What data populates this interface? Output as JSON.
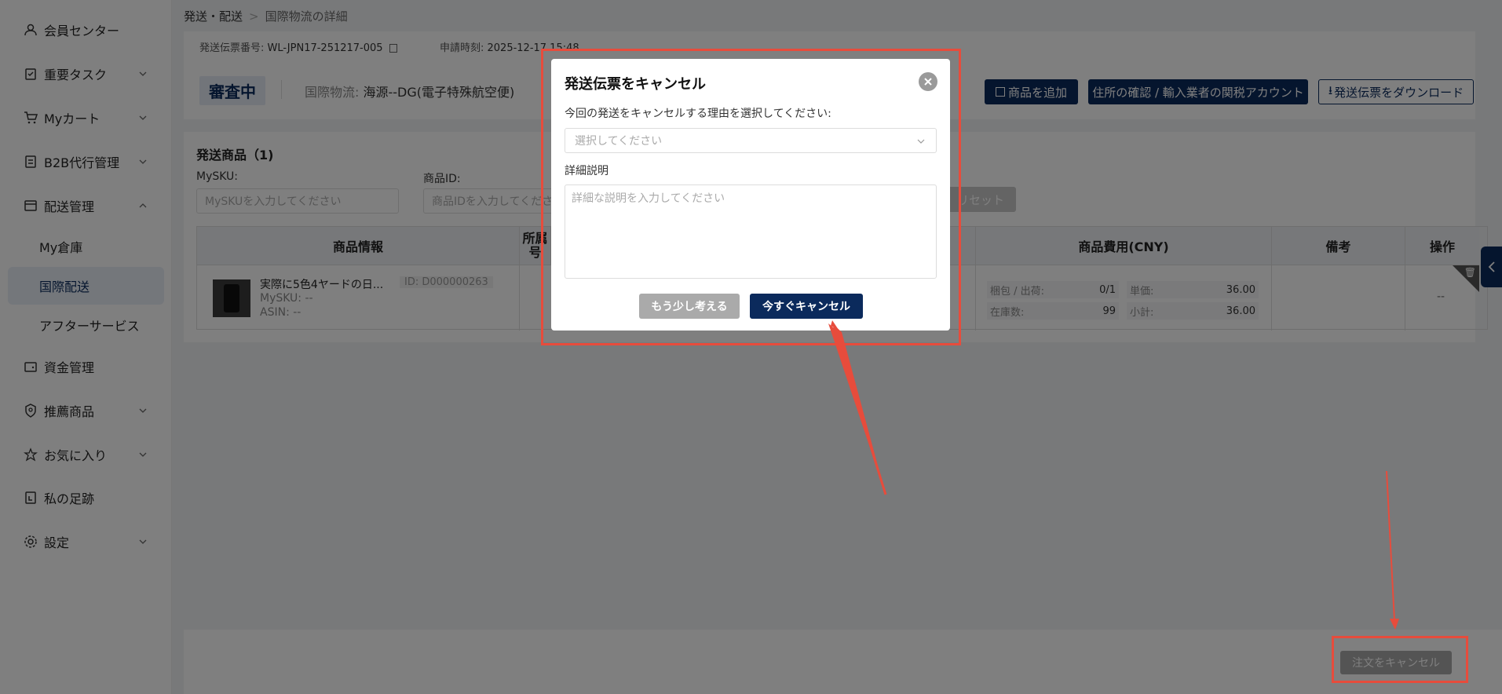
{
  "sidebar": {
    "items": [
      {
        "label": "会員センター"
      },
      {
        "label": "重要タスク"
      },
      {
        "label": "Myカート"
      },
      {
        "label": "B2B代行管理"
      },
      {
        "label": "配送管理"
      },
      {
        "label": "資金管理"
      },
      {
        "label": "推薦商品"
      },
      {
        "label": "お気に入り"
      },
      {
        "label": "私の足跡"
      },
      {
        "label": "設定"
      }
    ],
    "sub_items": [
      {
        "label": "My倉庫"
      },
      {
        "label": "国際配送",
        "active": true
      },
      {
        "label": "アフターサービス"
      }
    ]
  },
  "breadcrumb": {
    "parent": "発送・配送",
    "current": "国際物流の詳細"
  },
  "header": {
    "invoice_label": "発送伝票番号: ",
    "invoice_no": "WL-JPN17-251217-005",
    "applied_label": "申請時刻: ",
    "applied_at": "2025-12-17 15:48",
    "status": "審査中",
    "logistics_label": "国際物流: ",
    "logistics_value": "海源--DG(電子特殊航空便)",
    "add_goods": "商品を追加",
    "address_confirm": "住所の確認 / 輸入業者の関税アカウント",
    "download": "発送伝票をダウンロード"
  },
  "goods": {
    "title": "発送商品（1)",
    "filter_sku_label": "MySKU:",
    "filter_sku_placeholder": "MySKUを入力してください",
    "filter_id_label": "商品ID:",
    "filter_id_placeholder": "商品IDを入力してくださ",
    "reset": "リセット",
    "columns": {
      "info": "商品情報",
      "owner": "所属",
      "owner_suffix": "号",
      "cost": "商品費用(CNY)",
      "remark": "備考",
      "action": "操作"
    },
    "row": {
      "name": "実際に5色4ヤードの日...",
      "id": "ID: D000000263",
      "sku": "MySKU: --",
      "asin": "ASIN: --",
      "pack_label": "梱包 / 出荷:",
      "pack_value": "0/1",
      "unit_label": "単価:",
      "unit_value": "36.00",
      "stock_label": "在庫数:",
      "stock_value": "99",
      "subtotal_label": "小計:",
      "subtotal_value": "36.00",
      "action": "--"
    }
  },
  "footer": {
    "cancel_order": "注文をキャンセル"
  },
  "modal": {
    "title": "発送伝票をキャンセル",
    "reason_label": "今回の発送をキャンセルする理由を選択してください:",
    "reason_placeholder": "選択してください",
    "detail_label": "詳細説明",
    "detail_placeholder": "詳細な説明を入力してください",
    "think_more": "もう少し考える",
    "cancel_now": "今すぐキャンセル"
  },
  "colors": {
    "accent": "#0b2a5c",
    "annotation": "#e74c3c"
  }
}
